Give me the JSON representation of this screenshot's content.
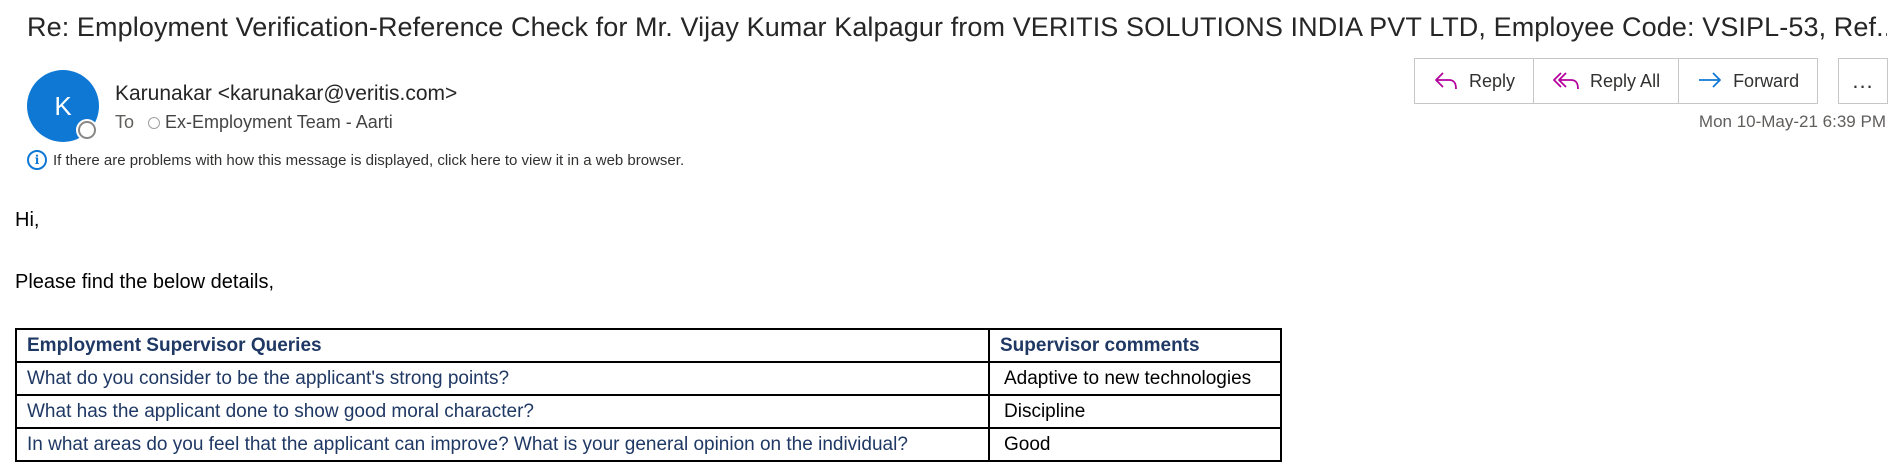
{
  "email": {
    "subject": "Re: Employment Verification-Reference Check for Mr. Vijay Kumar Kalpagur from VERITIS SOLUTIONS INDIA PVT LTD, Employee Code: VSIPL-53, Ref...",
    "avatar_initial": "K",
    "sender": "Karunakar <karunakar@veritis.com>",
    "to_label": "To",
    "recipient": "Ex-Employment Team - Aarti",
    "info_message": "If there are problems with how this message is displayed, click here to view it in a web browser.",
    "timestamp": "Mon 10-May-21 6:39 PM"
  },
  "actions": {
    "reply": "Reply",
    "reply_all": "Reply All",
    "forward": "Forward",
    "more": "..."
  },
  "body": {
    "greeting": "Hi,",
    "intro": "Please find the below details,"
  },
  "table": {
    "headers": [
      "Employment Supervisor Queries",
      "Supervisor comments"
    ],
    "rows": [
      [
        "What do you consider to be the applicant's strong points?",
        "Adaptive to new technologies"
      ],
      [
        "What has the applicant done to show good moral character?",
        "Discipline"
      ],
      [
        "In what areas do you feel that the applicant can improve? What is your general opinion on the individual?",
        "Good"
      ]
    ]
  },
  "colors": {
    "accent": "#0f78d4",
    "reply_icon": "#b4009e",
    "forward_icon": "#0f78d4",
    "table_header_text": "#1f3864"
  }
}
